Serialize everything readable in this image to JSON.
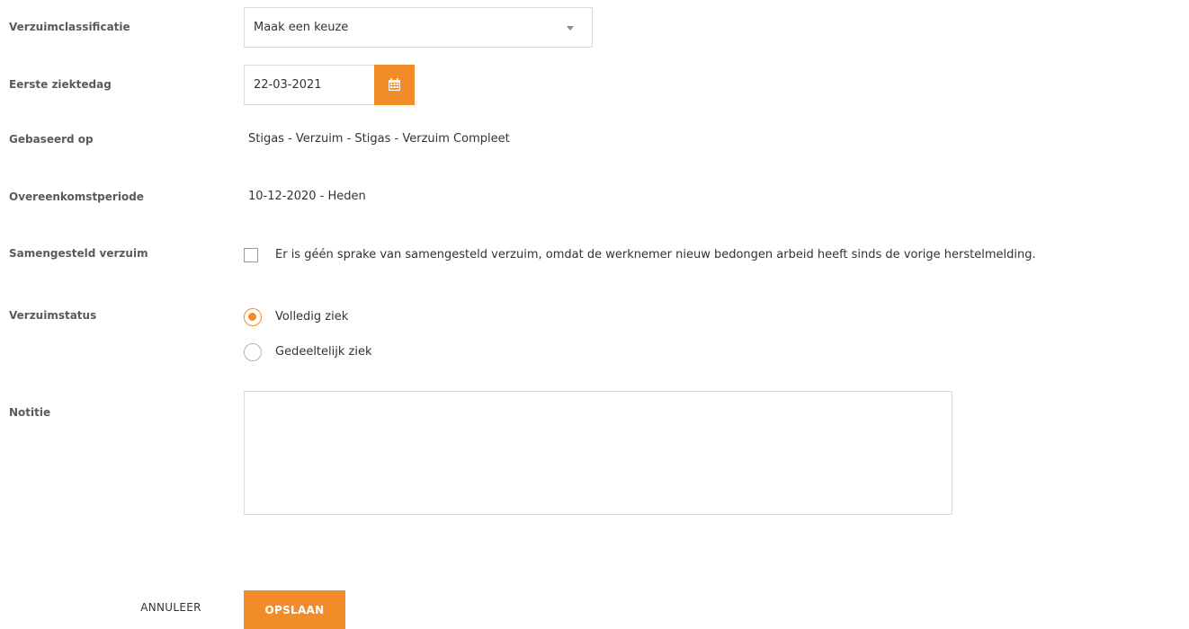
{
  "fields": {
    "verzuimclassificatie": {
      "label": "Verzuimclassificatie",
      "selected": "Maak een keuze"
    },
    "eerste_ziektedag": {
      "label": "Eerste ziektedag",
      "value": "22-03-2021"
    },
    "gebaseerd_op": {
      "label": "Gebaseerd op",
      "value": "Stigas - Verzuim - Stigas - Verzuim Compleet"
    },
    "overeenkomstperiode": {
      "label": "Overeenkomstperiode",
      "value": "10-12-2020 - Heden"
    },
    "samengesteld_verzuim": {
      "label": "Samengesteld verzuim",
      "checkbox_label": "Er is géén sprake van samengesteld verzuim, omdat de werknemer nieuw bedongen arbeid heeft sinds de vorige herstelmelding.",
      "checked": false
    },
    "verzuimstatus": {
      "label": "Verzuimstatus",
      "options": [
        {
          "label": "Volledig ziek",
          "checked": true
        },
        {
          "label": "Gedeeltelijk ziek",
          "checked": false
        }
      ]
    },
    "notitie": {
      "label": "Notitie",
      "value": ""
    }
  },
  "actions": {
    "cancel_label": "ANNULEER",
    "save_label": "OPSLAAN"
  },
  "colors": {
    "accent": "#f28c28",
    "border": "#dadada",
    "label": "#5a5a5a"
  }
}
